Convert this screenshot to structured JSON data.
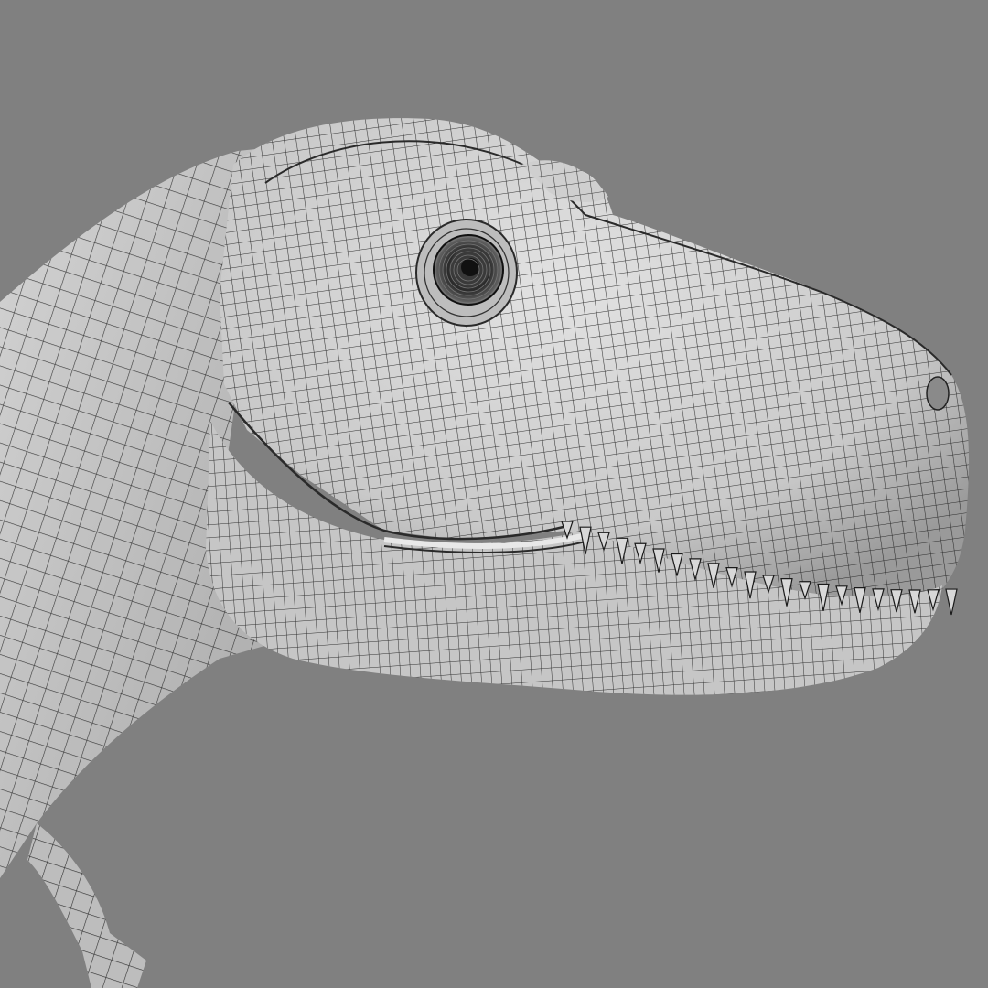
{
  "viewport": {
    "background_color": "#808080",
    "surface_color": "#c7c7c7",
    "wire_color": "#1a1a1a",
    "render_mode": "wireframe-on-shaded"
  },
  "model": {
    "subject": "dinosaur-head",
    "parts": [
      "head-skull",
      "neck",
      "eye",
      "upper-jaw-teeth",
      "lower-jaw",
      "foreleg"
    ]
  }
}
